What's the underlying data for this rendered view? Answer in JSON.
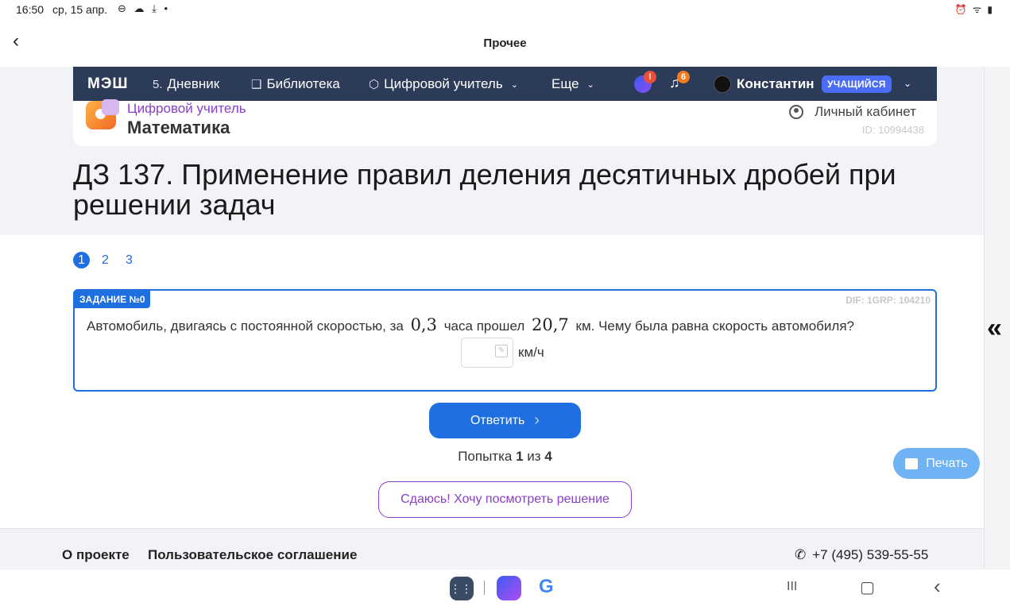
{
  "status": {
    "time": "16:50",
    "date": "ср, 15 апр.",
    "icons": "⊖ ☁ ⤓ •",
    "right_icons": "⏰ ᯤ ▮"
  },
  "appbar": {
    "back": "‹",
    "title": "Прочее"
  },
  "nav": {
    "logo": "МЭШ",
    "items": [
      {
        "icon": "5.",
        "label": "Дневник"
      },
      {
        "icon": "❑",
        "label": "Библиотека"
      },
      {
        "icon": "⬡",
        "label": "Цифровой учитель"
      },
      {
        "label": "Еще"
      }
    ],
    "chevron": "⌄",
    "app_badge": "!",
    "notifications_badge": "6",
    "user_name": "Константин",
    "user_role": "УЧАЩИЙСЯ"
  },
  "subject": {
    "category": "Цифровой учитель",
    "name": "Математика",
    "cabinet": "Личный кабинет",
    "user_id": "ID: 10994438"
  },
  "page_title": "ДЗ 137. Применение правил деления десятичных дробей при решении задач",
  "pager": [
    "1",
    "2",
    "3"
  ],
  "task": {
    "label": "ЗАДАНИЕ №0",
    "meta": "DIF: 1GRP: 104210",
    "text_1": "Автомобиль, двигаясь с постоянной скоростью, за",
    "num_1": "0,3",
    "text_2": "часа прошел",
    "num_2": "20,7",
    "text_3": "км. Чему была равна скорость автомобиля?",
    "answer_value": "",
    "unit": "км/ч"
  },
  "submit_label": "Ответить",
  "attempt": {
    "prefix": "Попытка",
    "current": "1",
    "middle": "из",
    "total": "4"
  },
  "giveup_label": "Сдаюсь! Хочу посмотреть решение",
  "print_label": "Печать",
  "collapse_icon": "«",
  "footer": {
    "about": "О проекте",
    "terms": "Пользовательское соглашение",
    "phone": "+7 (495) 539-55-55"
  },
  "android_nav": {
    "apps_icon": "⋮⋮⋮",
    "g": "G",
    "recent": "III",
    "home": "▢",
    "back": "‹"
  },
  "colors": {
    "nav_bg": "#2c3b57",
    "accent": "#1f6fe0",
    "purple": "#8a3fc7",
    "print": "#6fb3f4"
  }
}
